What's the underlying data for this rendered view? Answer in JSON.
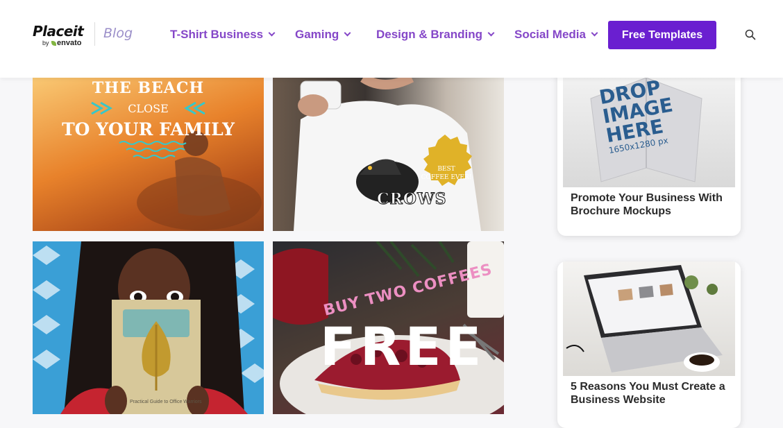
{
  "header": {
    "logo_word": "Placeit",
    "logo_by": "by",
    "logo_brand": "envato",
    "blog_label": "Blog",
    "nav": [
      {
        "label": "T-Shirt Business"
      },
      {
        "label": "Gaming"
      },
      {
        "label": "Design & Branding"
      },
      {
        "label": "Social Media"
      }
    ],
    "cta_label": "Free Templates",
    "accent": "#6a1fd0",
    "nav_color": "#8547c8"
  },
  "grid": {
    "beach": {
      "line1": "THE BEACH",
      "line2": "CLOSE",
      "line3": "TO YOUR FAMILY"
    },
    "crow": {
      "badge1": "BEST",
      "badge2": "COFFEE EVER!",
      "tee_brand": "CROWS"
    },
    "book": {
      "cover_text": "Practical Guide to Office Warriors"
    },
    "coffee": {
      "headline": "BUY TWO COFFEES",
      "big": "FREE"
    }
  },
  "sidebar": {
    "cards": [
      {
        "title": "Promote Your Business With Brochure Mockups",
        "img_text1": "DROP",
        "img_text2": "IMAGE",
        "img_text3": "HERE",
        "img_text4": "1650x1280 px"
      },
      {
        "title": "5 Reasons You Must Create a Business Website"
      }
    ]
  }
}
